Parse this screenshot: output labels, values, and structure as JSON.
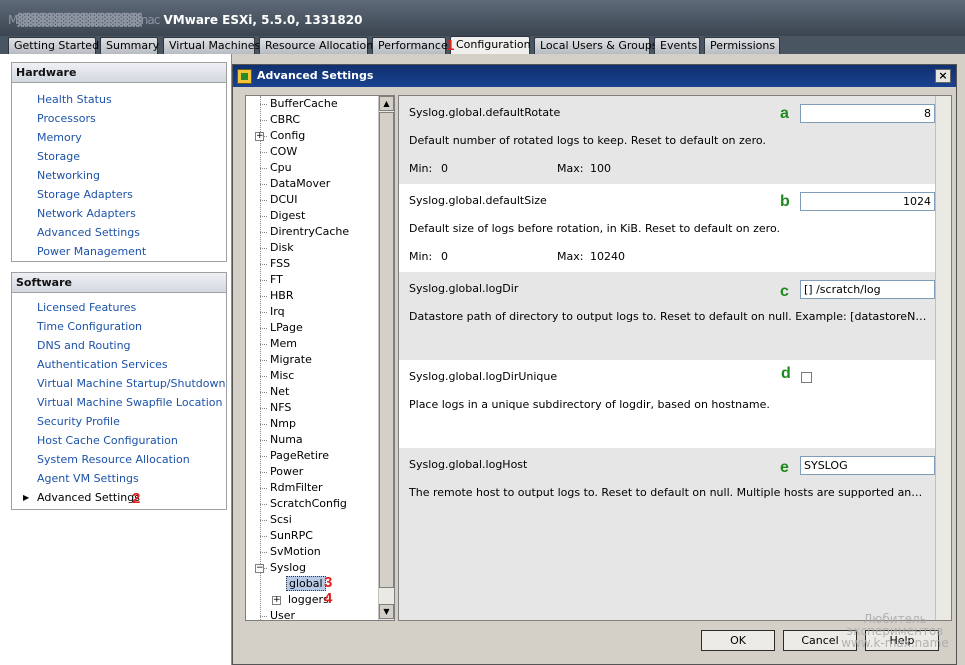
{
  "titlebar": {
    "host_blurred": "M▓▓▓▓▓▓▓▓▓▓▓▓▓▓▓nac",
    "product": " VMware ESXi, 5.5.0, 1331820"
  },
  "tabs": [
    {
      "label": "Getting Started"
    },
    {
      "label": "Summary"
    },
    {
      "label": "Virtual Machines"
    },
    {
      "label": "Resource Allocation"
    },
    {
      "label": "Performance"
    },
    {
      "label": "Configuration"
    },
    {
      "label": "Local Users & Groups"
    },
    {
      "label": "Events"
    },
    {
      "label": "Permissions"
    }
  ],
  "hardware": {
    "header": "Hardware",
    "items": [
      "Health Status",
      "Processors",
      "Memory",
      "Storage",
      "Networking",
      "Storage Adapters",
      "Network Adapters",
      "Advanced Settings",
      "Power Management"
    ]
  },
  "software": {
    "header": "Software",
    "items": [
      "Licensed Features",
      "Time Configuration",
      "DNS and Routing",
      "Authentication Services",
      "Virtual Machine Startup/Shutdown",
      "Virtual Machine Swapfile Location",
      "Security Profile",
      "Host Cache Configuration",
      "System Resource Allocation",
      "Agent VM Settings",
      "Advanced Settings"
    ]
  },
  "markers": {
    "m1": "1",
    "m2": "2",
    "m3": "3",
    "m4": "4",
    "a": "a",
    "b": "b",
    "c": "c",
    "d": "d",
    "e": "e"
  },
  "dialog": {
    "title": "Advanced Settings",
    "close": "×",
    "ok": "OK",
    "cancel": "Cancel",
    "help": "Help"
  },
  "tree": {
    "nodes": [
      "BufferCache",
      "CBRC",
      "Config",
      "COW",
      "Cpu",
      "DataMover",
      "DCUI",
      "Digest",
      "DirentryCache",
      "Disk",
      "FSS",
      "FT",
      "HBR",
      "Irq",
      "LPage",
      "Mem",
      "Migrate",
      "Misc",
      "Net",
      "NFS",
      "Nmp",
      "Numa",
      "PageRetire",
      "Power",
      "RdmFilter",
      "ScratchConfig",
      "Scsi",
      "SunRPC",
      "SvMotion",
      "Syslog",
      "global",
      "loggers",
      "User"
    ],
    "scroll_up": "▲",
    "scroll_down": "▼",
    "plus": "+",
    "minus": "−"
  },
  "settings": [
    {
      "name": "Syslog.global.defaultRotate",
      "desc": "Default number of rotated logs to keep. Reset to default on zero.",
      "min_label": "Min:",
      "min": "0",
      "max_label": "Max:",
      "max": "100",
      "value": "8"
    },
    {
      "name": "Syslog.global.defaultSize",
      "desc": "Default size of logs before rotation, in KiB. Reset to default on zero.",
      "min_label": "Min:",
      "min": "0",
      "max_label": "Max:",
      "max": "10240",
      "value": "1024"
    },
    {
      "name": "Syslog.global.logDir",
      "desc": "Datastore path of directory to output logs to. Reset to default on null. Example: [datastoreName]/logdir",
      "value": "[] /scratch/log"
    },
    {
      "name": "Syslog.global.logDirUnique",
      "desc": "Place logs in a unique subdirectory of logdir, based on hostname.",
      "checked": false
    },
    {
      "name": "Syslog.global.logHost",
      "desc": "The remote host to output logs to. Reset to default on null. Multiple hosts are supported and must be s...",
      "value": "SYSLOG"
    }
  ],
  "watermark": {
    "line1": "Любитель",
    "line2": "экспериментов",
    "line3": "www.k-max.name"
  }
}
